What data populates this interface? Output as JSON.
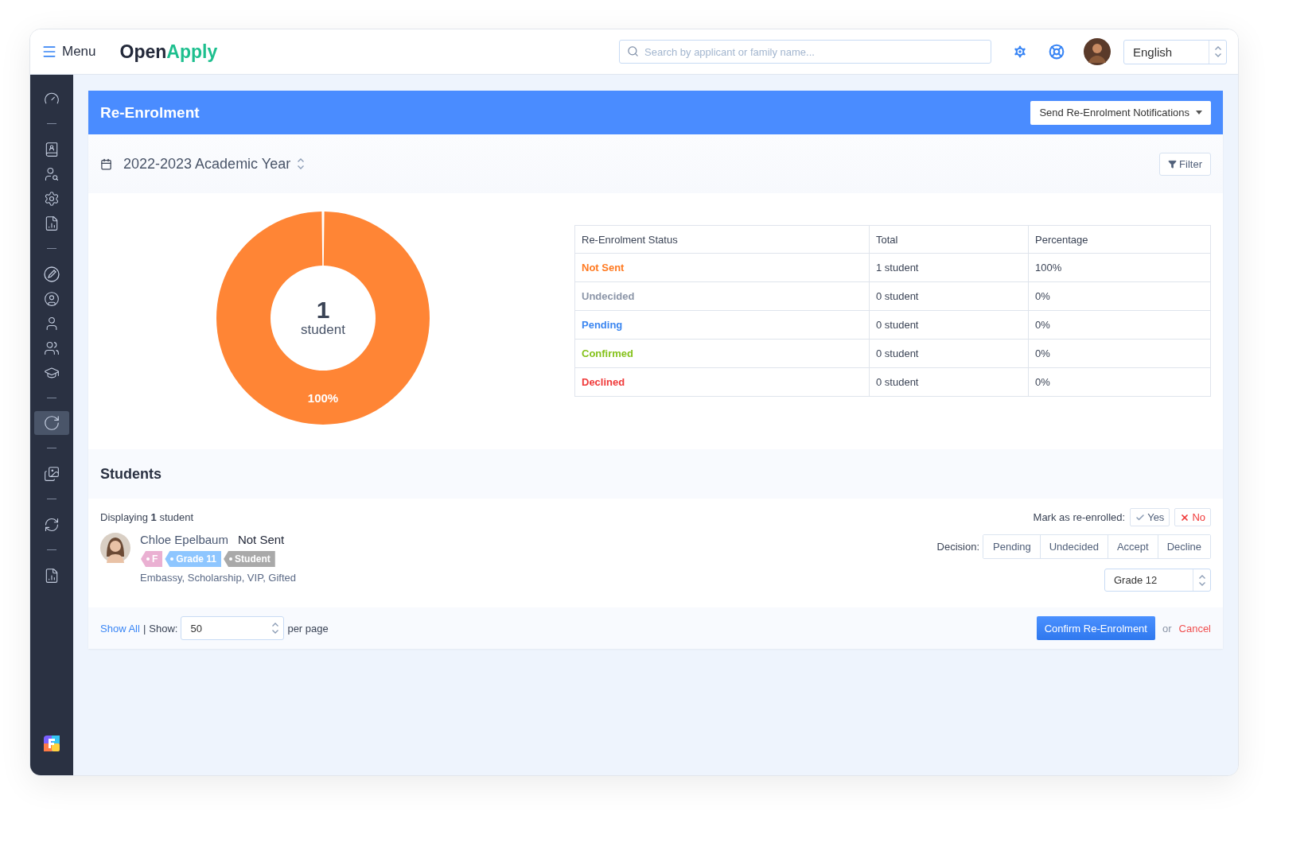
{
  "topbar": {
    "menu_label": "Menu",
    "logo": {
      "first": "Open",
      "second": "Apply"
    },
    "search": {
      "placeholder": "Search by applicant or family name..."
    },
    "language": "English"
  },
  "sidebar": {
    "groups": [
      {
        "items": [
          {
            "kind": "gauge",
            "selected": false
          }
        ]
      },
      {
        "items": [
          {
            "kind": "contacts",
            "selected": false
          },
          {
            "kind": "user-search",
            "selected": false
          },
          {
            "kind": "settings",
            "selected": false
          },
          {
            "kind": "report",
            "selected": false
          }
        ]
      },
      {
        "items": [
          {
            "kind": "pen",
            "selected": false
          },
          {
            "kind": "user-circle",
            "selected": false
          },
          {
            "kind": "user",
            "selected": false
          },
          {
            "kind": "users",
            "selected": false
          },
          {
            "kind": "graduation",
            "selected": false
          }
        ]
      },
      {
        "items": [
          {
            "kind": "reenrol",
            "selected": true
          }
        ]
      },
      {
        "items": [
          {
            "kind": "photos",
            "selected": false
          }
        ]
      },
      {
        "items": [
          {
            "kind": "refresh",
            "selected": false
          }
        ]
      },
      {
        "items": [
          {
            "kind": "report",
            "selected": false
          }
        ]
      }
    ]
  },
  "page": {
    "title": "Re-Enrolment",
    "action_button": "Send Re-Enrolment Notifications",
    "year": "2022-2023 Academic Year",
    "filter_button": "Filter"
  },
  "summary": {
    "center_value": "1",
    "center_label": "student",
    "ring": {
      "level": 1,
      "label": "100%"
    },
    "columns": [
      "Re-Enrolment Status",
      "Total",
      "Percentage"
    ],
    "rows": [
      {
        "status": "Not Sent",
        "color": "#ff7a21",
        "total": "1 student",
        "percentage": "100%"
      },
      {
        "status": "Undecided",
        "color": "#8c96a8",
        "total": "0 student",
        "percentage": "0%"
      },
      {
        "status": "Pending",
        "color": "#3b86f0",
        "total": "0 student",
        "percentage": "0%"
      },
      {
        "status": "Confirmed",
        "color": "#85c21b",
        "total": "0 student",
        "percentage": "0%"
      },
      {
        "status": "Declined",
        "color": "#f03a3a",
        "total": "0 student",
        "percentage": "0%"
      }
    ]
  },
  "students": {
    "heading": "Students",
    "displaying": "Displaying **1** student",
    "mark_label": "Mark as re-enrolled:",
    "mark_buttons": [
      {
        "kind": "yes",
        "label": "Yes"
      },
      {
        "kind": "no",
        "label": "No"
      }
    ],
    "list": [
      {
        "name": "Chloe Epelbaum",
        "status": "Not Sent",
        "tags": [
          {
            "label": "F",
            "color": "#eab0d2"
          },
          {
            "label": "Grade 11",
            "color": "#8ec6ff"
          },
          {
            "label": "Student",
            "color": "#a9a9a9"
          }
        ],
        "groups": "Embassy, Scholarship, VIP, Gifted",
        "decision_label": "Decision:",
        "decisions": [
          {
            "label": "Pending",
            "selected": false
          },
          {
            "label": "Undecided",
            "selected": false
          },
          {
            "label": "Accept",
            "selected": false
          },
          {
            "label": "Decline",
            "selected": false
          }
        ],
        "next_grade": "Grade 12"
      }
    ]
  },
  "footer": {
    "show_all": "Show All",
    "separator": "|",
    "show_label": "Show:",
    "per_page_value": "50",
    "per_page_label": "per page",
    "confirm_button": "Confirm Re-Enrolment",
    "or": "or",
    "cancel": "Cancel"
  }
}
